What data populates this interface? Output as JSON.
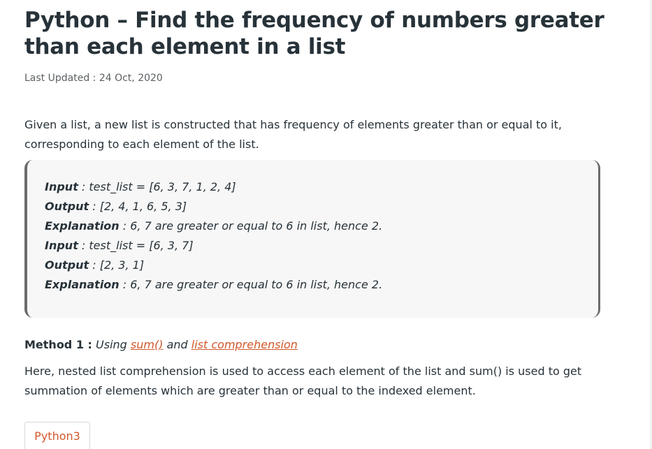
{
  "article": {
    "title": "Python – Find the frequency of numbers greater than each element in a list",
    "last_updated_label": "Last Updated :",
    "last_updated_date": "24 Oct, 2020",
    "intro": "Given a list, a new list is constructed that has frequency of elements greater than or equal to it, corresponding to each element of the list."
  },
  "example": {
    "lines": [
      {
        "key": "Input",
        "text": " : test_list = [6, 3, 7, 1, 2, 4]"
      },
      {
        "key": "Output",
        "text": " : [2, 4, 1, 6, 5, 3]"
      },
      {
        "key": "Explanation",
        "text": " : 6, 7 are greater or equal to 6 in list, hence 2."
      },
      {
        "key": "Input",
        "text": " : test_list = [6, 3, 7]"
      },
      {
        "key": "Output",
        "text": " : [2, 3, 1]"
      },
      {
        "key": "Explanation",
        "text": " : 6, 7 are greater or equal to 6 in list, hence 2."
      }
    ]
  },
  "method": {
    "label": "Method 1 :",
    "using": "Using",
    "link1": "sum()",
    "and": "and",
    "link2": "list comprehension",
    "description": "Here, nested list comprehension is used to access each element of the list and sum() is used to get summation of elements which are greater than or equal to the indexed element."
  },
  "code": {
    "tab_label": "Python3"
  },
  "colors": {
    "link": "#d2582a",
    "text": "#273239",
    "box_background": "#f7f7f7",
    "box_border": "#6b6b6b"
  }
}
